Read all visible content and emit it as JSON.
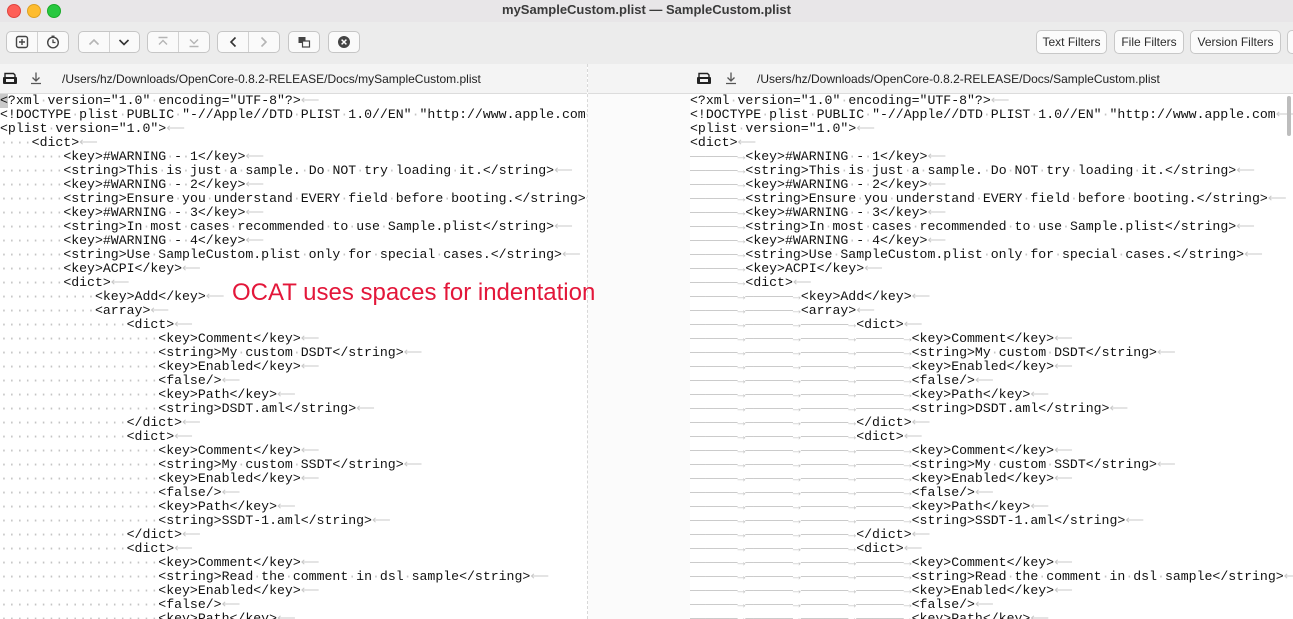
{
  "window": {
    "title": "mySampleCustom.plist — SampleCustom.plist"
  },
  "toolbar": {
    "text_filters": "Text Filters",
    "file_filters": "File Filters",
    "version_filters": "Version Filters"
  },
  "left_pane": {
    "path": "/Users/hz/Downloads/OpenCore-0.8.2-RELEASE/Docs/mySampleCustom.plist",
    "lines": [
      {
        "indent": 0,
        "text": "<?xml version=\"1.0\" encoding=\"UTF-8\"?>"
      },
      {
        "indent": 0,
        "text": "<!DOCTYPE plist PUBLIC \"-//Apple//DTD PLIST 1.0//EN\" \"http://www.apple.com"
      },
      {
        "indent": 0,
        "text": "<plist version=\"1.0\">"
      },
      {
        "indent": 1,
        "text": "<dict>"
      },
      {
        "indent": 2,
        "text": "<key>#WARNING - 1</key>"
      },
      {
        "indent": 2,
        "text": "<string>This is just a sample. Do NOT try loading it.</string>"
      },
      {
        "indent": 2,
        "text": "<key>#WARNING - 2</key>"
      },
      {
        "indent": 2,
        "text": "<string>Ensure you understand EVERY field before booting.</string>"
      },
      {
        "indent": 2,
        "text": "<key>#WARNING - 3</key>"
      },
      {
        "indent": 2,
        "text": "<string>In most cases recommended to use Sample.plist</string>"
      },
      {
        "indent": 2,
        "text": "<key>#WARNING - 4</key>"
      },
      {
        "indent": 2,
        "text": "<string>Use SampleCustom.plist only for special cases.</string>"
      },
      {
        "indent": 2,
        "text": "<key>ACPI</key>"
      },
      {
        "indent": 2,
        "text": "<dict>"
      },
      {
        "indent": 3,
        "text": "<key>Add</key>"
      },
      {
        "indent": 3,
        "text": "<array>"
      },
      {
        "indent": 4,
        "text": "<dict>"
      },
      {
        "indent": 5,
        "text": "<key>Comment</key>"
      },
      {
        "indent": 5,
        "text": "<string>My custom DSDT</string>"
      },
      {
        "indent": 5,
        "text": "<key>Enabled</key>"
      },
      {
        "indent": 5,
        "text": "<false/>"
      },
      {
        "indent": 5,
        "text": "<key>Path</key>"
      },
      {
        "indent": 5,
        "text": "<string>DSDT.aml</string>"
      },
      {
        "indent": 4,
        "text": "</dict>"
      },
      {
        "indent": 4,
        "text": "<dict>"
      },
      {
        "indent": 5,
        "text": "<key>Comment</key>"
      },
      {
        "indent": 5,
        "text": "<string>My custom SSDT</string>"
      },
      {
        "indent": 5,
        "text": "<key>Enabled</key>"
      },
      {
        "indent": 5,
        "text": "<false/>"
      },
      {
        "indent": 5,
        "text": "<key>Path</key>"
      },
      {
        "indent": 5,
        "text": "<string>SSDT-1.aml</string>"
      },
      {
        "indent": 4,
        "text": "</dict>"
      },
      {
        "indent": 4,
        "text": "<dict>"
      },
      {
        "indent": 5,
        "text": "<key>Comment</key>"
      },
      {
        "indent": 5,
        "text": "<string>Read the comment in dsl sample</string>"
      },
      {
        "indent": 5,
        "text": "<key>Enabled</key>"
      },
      {
        "indent": 5,
        "text": "<false/>"
      },
      {
        "indent": 5,
        "text": "<key>Path</key>"
      }
    ]
  },
  "right_pane": {
    "path": "/Users/hz/Downloads/OpenCore-0.8.2-RELEASE/Docs/SampleCustom.plist",
    "lines": [
      {
        "indent": 0,
        "text": "<?xml version=\"1.0\" encoding=\"UTF-8\"?>"
      },
      {
        "indent": 0,
        "text": "<!DOCTYPE plist PUBLIC \"-//Apple//DTD PLIST 1.0//EN\" \"http://www.apple.com"
      },
      {
        "indent": 0,
        "text": "<plist version=\"1.0\">"
      },
      {
        "indent": 0,
        "text": "<dict>"
      },
      {
        "indent": 1,
        "text": "<key>#WARNING - 1</key>"
      },
      {
        "indent": 1,
        "text": "<string>This is just a sample. Do NOT try loading it.</string>"
      },
      {
        "indent": 1,
        "text": "<key>#WARNING - 2</key>"
      },
      {
        "indent": 1,
        "text": "<string>Ensure you understand EVERY field before booting.</string>"
      },
      {
        "indent": 1,
        "text": "<key>#WARNING - 3</key>"
      },
      {
        "indent": 1,
        "text": "<string>In most cases recommended to use Sample.plist</string>"
      },
      {
        "indent": 1,
        "text": "<key>#WARNING - 4</key>"
      },
      {
        "indent": 1,
        "text": "<string>Use SampleCustom.plist only for special cases.</string>"
      },
      {
        "indent": 1,
        "text": "<key>ACPI</key>"
      },
      {
        "indent": 1,
        "text": "<dict>"
      },
      {
        "indent": 2,
        "text": "<key>Add</key>"
      },
      {
        "indent": 2,
        "text": "<array>"
      },
      {
        "indent": 3,
        "text": "<dict>"
      },
      {
        "indent": 4,
        "text": "<key>Comment</key>"
      },
      {
        "indent": 4,
        "text": "<string>My custom DSDT</string>"
      },
      {
        "indent": 4,
        "text": "<key>Enabled</key>"
      },
      {
        "indent": 4,
        "text": "<false/>"
      },
      {
        "indent": 4,
        "text": "<key>Path</key>"
      },
      {
        "indent": 4,
        "text": "<string>DSDT.aml</string>"
      },
      {
        "indent": 3,
        "text": "</dict>"
      },
      {
        "indent": 3,
        "text": "<dict>"
      },
      {
        "indent": 4,
        "text": "<key>Comment</key>"
      },
      {
        "indent": 4,
        "text": "<string>My custom SSDT</string>"
      },
      {
        "indent": 4,
        "text": "<key>Enabled</key>"
      },
      {
        "indent": 4,
        "text": "<false/>"
      },
      {
        "indent": 4,
        "text": "<key>Path</key>"
      },
      {
        "indent": 4,
        "text": "<string>SSDT-1.aml</string>"
      },
      {
        "indent": 3,
        "text": "</dict>"
      },
      {
        "indent": 3,
        "text": "<dict>"
      },
      {
        "indent": 4,
        "text": "<key>Comment</key>"
      },
      {
        "indent": 4,
        "text": "<string>Read the comment in dsl sample</string>"
      },
      {
        "indent": 4,
        "text": "<key>Enabled</key>"
      },
      {
        "indent": 4,
        "text": "<false/>"
      },
      {
        "indent": 4,
        "text": "<key>Path</key>"
      }
    ]
  },
  "annotation": "OCAT uses spaces for indentation",
  "colors": {
    "annotation": "#e3173a",
    "whitespace_marker": "#c4c4c4"
  }
}
